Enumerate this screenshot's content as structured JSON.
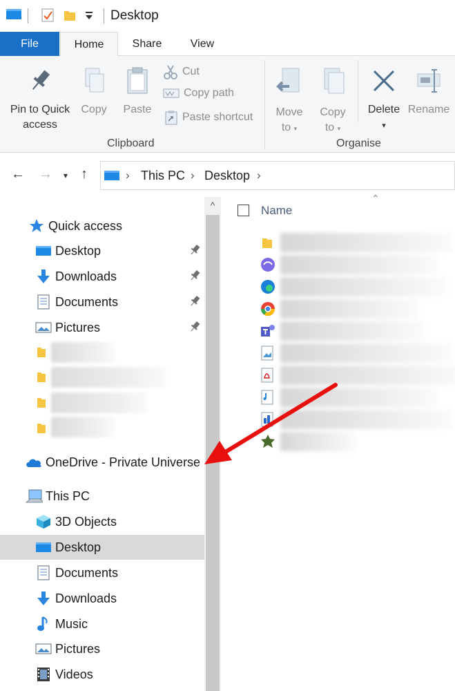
{
  "window": {
    "title": "Desktop"
  },
  "tabs": {
    "file": "File",
    "home": "Home",
    "share": "Share",
    "view": "View"
  },
  "ribbon": {
    "pin": "Pin to Quick access",
    "pin_line1": "Pin to Quick",
    "pin_line2": "access",
    "copy": "Copy",
    "paste": "Paste",
    "cut": "Cut",
    "copy_path": "Copy path",
    "paste_shortcut": "Paste shortcut",
    "clipboard_group": "Clipboard",
    "move_to_line1": "Move",
    "move_to_line2": "to",
    "copy_to_line1": "Copy",
    "copy_to_line2": "to",
    "delete": "Delete",
    "rename": "Rename",
    "organise_group": "Organise"
  },
  "address": {
    "crumbs": [
      "This PC",
      "Desktop"
    ]
  },
  "navpane": {
    "quick_access": "Quick access",
    "quick_items": [
      {
        "label": "Desktop"
      },
      {
        "label": "Downloads"
      },
      {
        "label": "Documents"
      },
      {
        "label": "Pictures"
      }
    ],
    "onedrive": "OneDrive - Private Universe",
    "this_pc": "This PC",
    "pc_items": [
      {
        "label": "3D Objects"
      },
      {
        "label": "Desktop"
      },
      {
        "label": "Documents"
      },
      {
        "label": "Downloads"
      },
      {
        "label": "Music"
      },
      {
        "label": "Pictures"
      },
      {
        "label": "Videos"
      }
    ]
  },
  "filelist": {
    "column_name": "Name"
  },
  "colors": {
    "accent": "#1a6fc7",
    "arrow": "#e8100f",
    "selected": "#d9d9d9"
  }
}
